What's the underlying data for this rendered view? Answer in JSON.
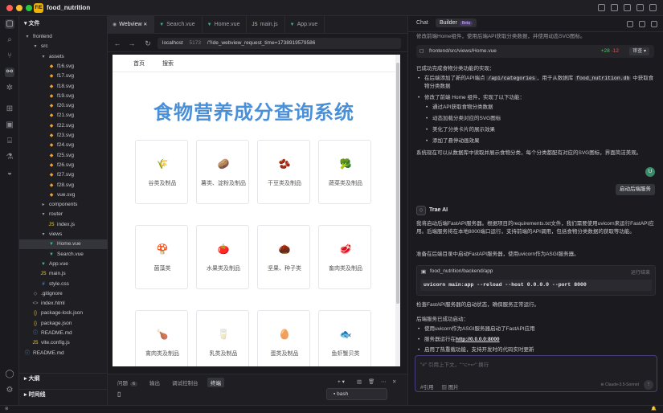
{
  "app": {
    "logo": "F/E",
    "name": "food_nutrition"
  },
  "sidebar": {
    "title": "文件",
    "tree": [
      {
        "label": "frontend",
        "indent": 0,
        "icon": "▾",
        "kind": "folder"
      },
      {
        "label": "src",
        "indent": 1,
        "icon": "▾",
        "kind": "folder"
      },
      {
        "label": "assets",
        "indent": 2,
        "icon": "▾",
        "kind": "folder"
      },
      {
        "label": "f16.svg",
        "indent": 3,
        "icon": "◆",
        "kind": "svg"
      },
      {
        "label": "f17.svg",
        "indent": 3,
        "icon": "◆",
        "kind": "svg"
      },
      {
        "label": "f18.svg",
        "indent": 3,
        "icon": "◆",
        "kind": "svg"
      },
      {
        "label": "f19.svg",
        "indent": 3,
        "icon": "◆",
        "kind": "svg"
      },
      {
        "label": "f20.svg",
        "indent": 3,
        "icon": "◆",
        "kind": "svg"
      },
      {
        "label": "f21.svg",
        "indent": 3,
        "icon": "◆",
        "kind": "svg"
      },
      {
        "label": "f22.svg",
        "indent": 3,
        "icon": "◆",
        "kind": "svg"
      },
      {
        "label": "f23.svg",
        "indent": 3,
        "icon": "◆",
        "kind": "svg"
      },
      {
        "label": "f24.svg",
        "indent": 3,
        "icon": "◆",
        "kind": "svg"
      },
      {
        "label": "f25.svg",
        "indent": 3,
        "icon": "◆",
        "kind": "svg"
      },
      {
        "label": "f26.svg",
        "indent": 3,
        "icon": "◆",
        "kind": "svg"
      },
      {
        "label": "f27.svg",
        "indent": 3,
        "icon": "◆",
        "kind": "svg"
      },
      {
        "label": "f28.svg",
        "indent": 3,
        "icon": "◆",
        "kind": "svg"
      },
      {
        "label": "vue.svg",
        "indent": 3,
        "icon": "◆",
        "kind": "svg"
      },
      {
        "label": "components",
        "indent": 2,
        "icon": "▸",
        "kind": "folder"
      },
      {
        "label": "router",
        "indent": 2,
        "icon": "▾",
        "kind": "folder"
      },
      {
        "label": "index.js",
        "indent": 3,
        "icon": "JS",
        "kind": "js"
      },
      {
        "label": "views",
        "indent": 2,
        "icon": "▾",
        "kind": "folder"
      },
      {
        "label": "Home.vue",
        "indent": 3,
        "icon": "▼",
        "kind": "vue",
        "selected": true
      },
      {
        "label": "Search.vue",
        "indent": 3,
        "icon": "▼",
        "kind": "vue"
      },
      {
        "label": "App.vue",
        "indent": 2,
        "icon": "▼",
        "kind": "vue"
      },
      {
        "label": "main.js",
        "indent": 2,
        "icon": "JS",
        "kind": "js"
      },
      {
        "label": "style.css",
        "indent": 2,
        "icon": "#",
        "kind": "css"
      },
      {
        "label": ".gitignore",
        "indent": 1,
        "icon": "◇",
        "kind": "other"
      },
      {
        "label": "index.html",
        "indent": 1,
        "icon": "<>",
        "kind": "other"
      },
      {
        "label": "package-lock.json",
        "indent": 1,
        "icon": "{}",
        "kind": "json"
      },
      {
        "label": "package.json",
        "indent": 1,
        "icon": "{}",
        "kind": "json"
      },
      {
        "label": "README.md",
        "indent": 1,
        "icon": "ⓘ",
        "kind": "md"
      },
      {
        "label": "vite.config.js",
        "indent": 1,
        "icon": "JS",
        "kind": "js"
      },
      {
        "label": "README.md",
        "indent": 0,
        "icon": "ⓘ",
        "kind": "md"
      }
    ],
    "outline_label": "大纲",
    "timeline_label": "时间线"
  },
  "editor": {
    "tabs": [
      {
        "label": "Webview",
        "icon": "◉",
        "active": true,
        "closable": true
      },
      {
        "label": "Search.vue",
        "icon": "▼"
      },
      {
        "label": "Home.vue",
        "icon": "▼"
      },
      {
        "label": "main.js",
        "icon": "JS"
      },
      {
        "label": "App.vue",
        "icon": "▼"
      }
    ],
    "url": {
      "host": "localhost",
      "port": "5173",
      "path": "/?ide_webview_request_time=1738919579586"
    }
  },
  "webpage": {
    "nav": [
      "首页",
      "搜索"
    ],
    "title": "食物营养成分查询系统",
    "categories": [
      {
        "label": "谷类及制品",
        "icon": "🌾"
      },
      {
        "label": "薯类、淀粉及制品",
        "icon": "🥔"
      },
      {
        "label": "干豆类及制品",
        "icon": "🫘"
      },
      {
        "label": "蔬菜类及制品",
        "icon": "🥦"
      },
      {
        "label": "菌藻类",
        "icon": "🍄"
      },
      {
        "label": "水果类及制品",
        "icon": "🍅"
      },
      {
        "label": "坚果、种子类",
        "icon": "🌰"
      },
      {
        "label": "畜肉类及制品",
        "icon": "🥩"
      },
      {
        "label": "禽肉类及制品",
        "icon": "🍗"
      },
      {
        "label": "乳类及制品",
        "icon": "🥛"
      },
      {
        "label": "蛋类及制品",
        "icon": "🥚"
      },
      {
        "label": "鱼虾蟹贝类",
        "icon": "🐟"
      }
    ]
  },
  "panel": {
    "tabs": [
      {
        "label": "问题",
        "badge": "6"
      },
      {
        "label": "输出"
      },
      {
        "label": "调试控制台"
      },
      {
        "label": "终端",
        "active": true
      }
    ],
    "terminal_name": "bash",
    "prompt": "▯"
  },
  "chat": {
    "tabs": [
      "Chat",
      "Builder"
    ],
    "beta": "Beta",
    "partial_top": "修改前端Home组件，使用后端API获取分类数据，并使用动态SVG图标。",
    "file_ref": {
      "path": "frontend/src/views/Home.vue",
      "plus": "+28",
      "minus": "-12",
      "action": "审查"
    },
    "summary_intro": "已成功完成食物分类功能的实现：",
    "bullets": [
      {
        "text_before": "在后端添加了新的API端点 ",
        "code": "/api/categories",
        "text_mid": "，用于从数据库 ",
        "code2": "food_nutrition.db",
        "text_after": " 中获取食物分类数据"
      },
      {
        "text": "修改了前端 Home 组件，实现了以下功能："
      }
    ],
    "subbullets": [
      "通过API获取食物分类数据",
      "动态加载分类对应的SVG图标",
      "美化了分类卡片的展示效果",
      "添加了悬停动画效果"
    ],
    "summary_outro": "系统现在可以从数据库中读取并展示食物分类，每个分类都配有对应的SVG图标，界面简洁美观。",
    "user_message": "启动后端服务",
    "ai_name": "Trae AI",
    "ai_para1": "我将启动后端FastAPI服务器。根据项目的requirements.txt文件，我们需要使用uvicorn来运行FastAPI应用。后端服务将在本地8000端口运行，支持前端的API调用，包括食物分类数据的获取等功能。",
    "ai_para2": "准备在后端目录中启动FastAPI服务器，使用uvicorn作为ASGI服务器。",
    "cmd": {
      "dir": "food_nutrition/backend/app",
      "status": "运行结束",
      "command": "uvicorn main:app --reload --host 0.0.0.0 --port 8000"
    },
    "ai_para3": "检查FastAPI服务器的启动状态，确保服务正常运行。",
    "ai_para4": "后端服务已成功启动：",
    "final_bullets": [
      {
        "text": "使用uvicorn作为ASGI服务器启动了FastAPI应用"
      },
      {
        "text_before": "服务器运行在",
        "link": "http://0.0.0.0:8000"
      },
      {
        "text": "启用了热重载功能，支持开发时的代码实时更新"
      }
    ],
    "input_placeholder": "\"#\" 引用上下文，\"⌥+↩\" 换行",
    "input_ref": "#引用",
    "input_image": "图片",
    "model": "Claude-3.5-Sonnet"
  },
  "colors": {
    "accent": "#4a90d9",
    "beta_bg": "#4a3a70",
    "diff_plus": "#5cc070",
    "diff_minus": "#e05a5a"
  }
}
